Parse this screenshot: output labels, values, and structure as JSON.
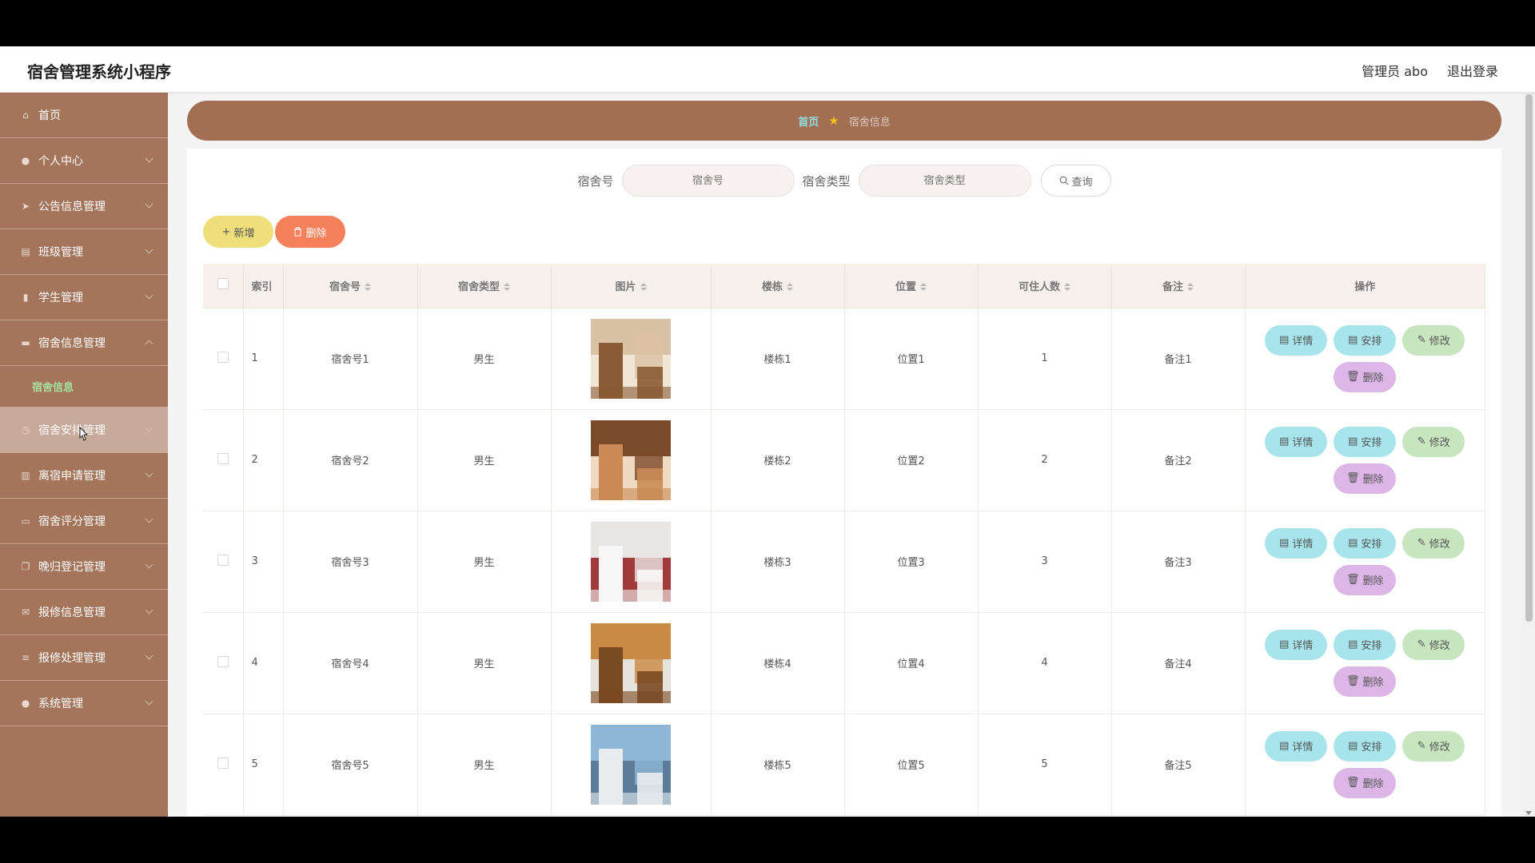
{
  "header": {
    "title": "宿舍管理系统小程序",
    "admin": "管理员 abo",
    "logout": "退出登录"
  },
  "sidebar": {
    "items": [
      {
        "label": "首页",
        "icon": "home-icon"
      },
      {
        "label": "个人中心",
        "icon": "user-icon"
      },
      {
        "label": "公告信息管理",
        "icon": "send-icon"
      },
      {
        "label": "班级管理",
        "icon": "list-icon"
      },
      {
        "label": "学生管理",
        "icon": "bar-chart-icon"
      },
      {
        "label": "宿舍信息管理",
        "icon": "bed-icon",
        "expanded": true,
        "sub": "宿舍信息"
      },
      {
        "label": "宿舍安排管理",
        "icon": "clock-icon",
        "hover": true
      },
      {
        "label": "离宿申请管理",
        "icon": "columns-icon"
      },
      {
        "label": "宿舍评分管理",
        "icon": "card-icon"
      },
      {
        "label": "晚归登记管理",
        "icon": "copy-icon"
      },
      {
        "label": "报修信息管理",
        "icon": "mail-icon"
      },
      {
        "label": "报修处理管理",
        "icon": "menu-icon"
      },
      {
        "label": "系统管理",
        "icon": "person-icon"
      }
    ]
  },
  "breadcrumb": {
    "home": "首页",
    "current": "宿舍信息"
  },
  "search": {
    "room_label": "宿舍号",
    "room_placeholder": "宿舍号",
    "type_label": "宿舍类型",
    "type_placeholder": "宿舍类型",
    "query": "查询"
  },
  "toolbar": {
    "add": "新增",
    "delete": "删除"
  },
  "table": {
    "columns": [
      "索引",
      "宿舍号",
      "宿舍类型",
      "图片",
      "楼栋",
      "位置",
      "可住人数",
      "备注",
      "操作"
    ],
    "ops": {
      "detail": "详情",
      "arrange": "安排",
      "edit": "修改",
      "delete": "删除"
    },
    "rows": [
      {
        "index": "1",
        "room": "宿舍号1",
        "type": "男生",
        "building": "楼栋1",
        "position": "位置1",
        "capacity": "1",
        "note": "备注1"
      },
      {
        "index": "2",
        "room": "宿舍号2",
        "type": "男生",
        "building": "楼栋2",
        "position": "位置2",
        "capacity": "2",
        "note": "备注2"
      },
      {
        "index": "3",
        "room": "宿舍号3",
        "type": "男生",
        "building": "楼栋3",
        "position": "位置3",
        "capacity": "3",
        "note": "备注3"
      },
      {
        "index": "4",
        "room": "宿舍号4",
        "type": "男生",
        "building": "楼栋4",
        "position": "位置4",
        "capacity": "4",
        "note": "备注4"
      },
      {
        "index": "5",
        "room": "宿舍号5",
        "type": "男生",
        "building": "楼栋5",
        "position": "位置5",
        "capacity": "5",
        "note": "备注5"
      }
    ]
  },
  "colors": {
    "sidebar": "#a5755b",
    "breadcrumb": "#a36f54",
    "add_button": "#eedf7a",
    "delete_button": "#f5805a",
    "detail_button": "#a8e4ec",
    "edit_button": "#c7e6c0",
    "row_delete_button": "#dcb6e6"
  }
}
